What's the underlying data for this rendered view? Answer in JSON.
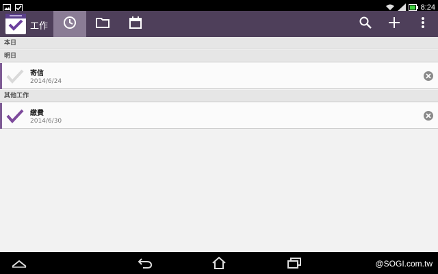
{
  "status_bar": {
    "time": "8:24",
    "icons": [
      "image-icon",
      "checkbox-icon",
      "wifi-icon",
      "signal-icon",
      "battery-icon"
    ]
  },
  "action_bar": {
    "app_title": "工作",
    "tabs": [
      {
        "icon": "clock-icon",
        "active": true
      },
      {
        "icon": "folder-icon",
        "active": false
      },
      {
        "icon": "calendar-icon",
        "active": false
      }
    ],
    "actions": [
      "search-icon",
      "add-icon",
      "overflow-menu-icon"
    ],
    "accent_color": "#4e3f5a",
    "active_tab_color": "#8a7c95"
  },
  "sections": [
    {
      "title": "本日",
      "tasks": []
    },
    {
      "title": "明日",
      "tasks": [
        {
          "title": "寄信",
          "date": "2014/6/24",
          "checked": false
        }
      ]
    },
    {
      "title": "其他工作",
      "tasks": [
        {
          "title": "繳費",
          "date": "2014/6/30",
          "checked": true
        }
      ]
    }
  ],
  "nav_bar": {
    "buttons": [
      "collapse-icon",
      "back-icon",
      "home-icon",
      "recent-apps-icon"
    ],
    "watermark": "@SOGI.com.tw"
  },
  "colors": {
    "check_done": "#7d4a9c",
    "check_undone": "#d9d9d9"
  }
}
